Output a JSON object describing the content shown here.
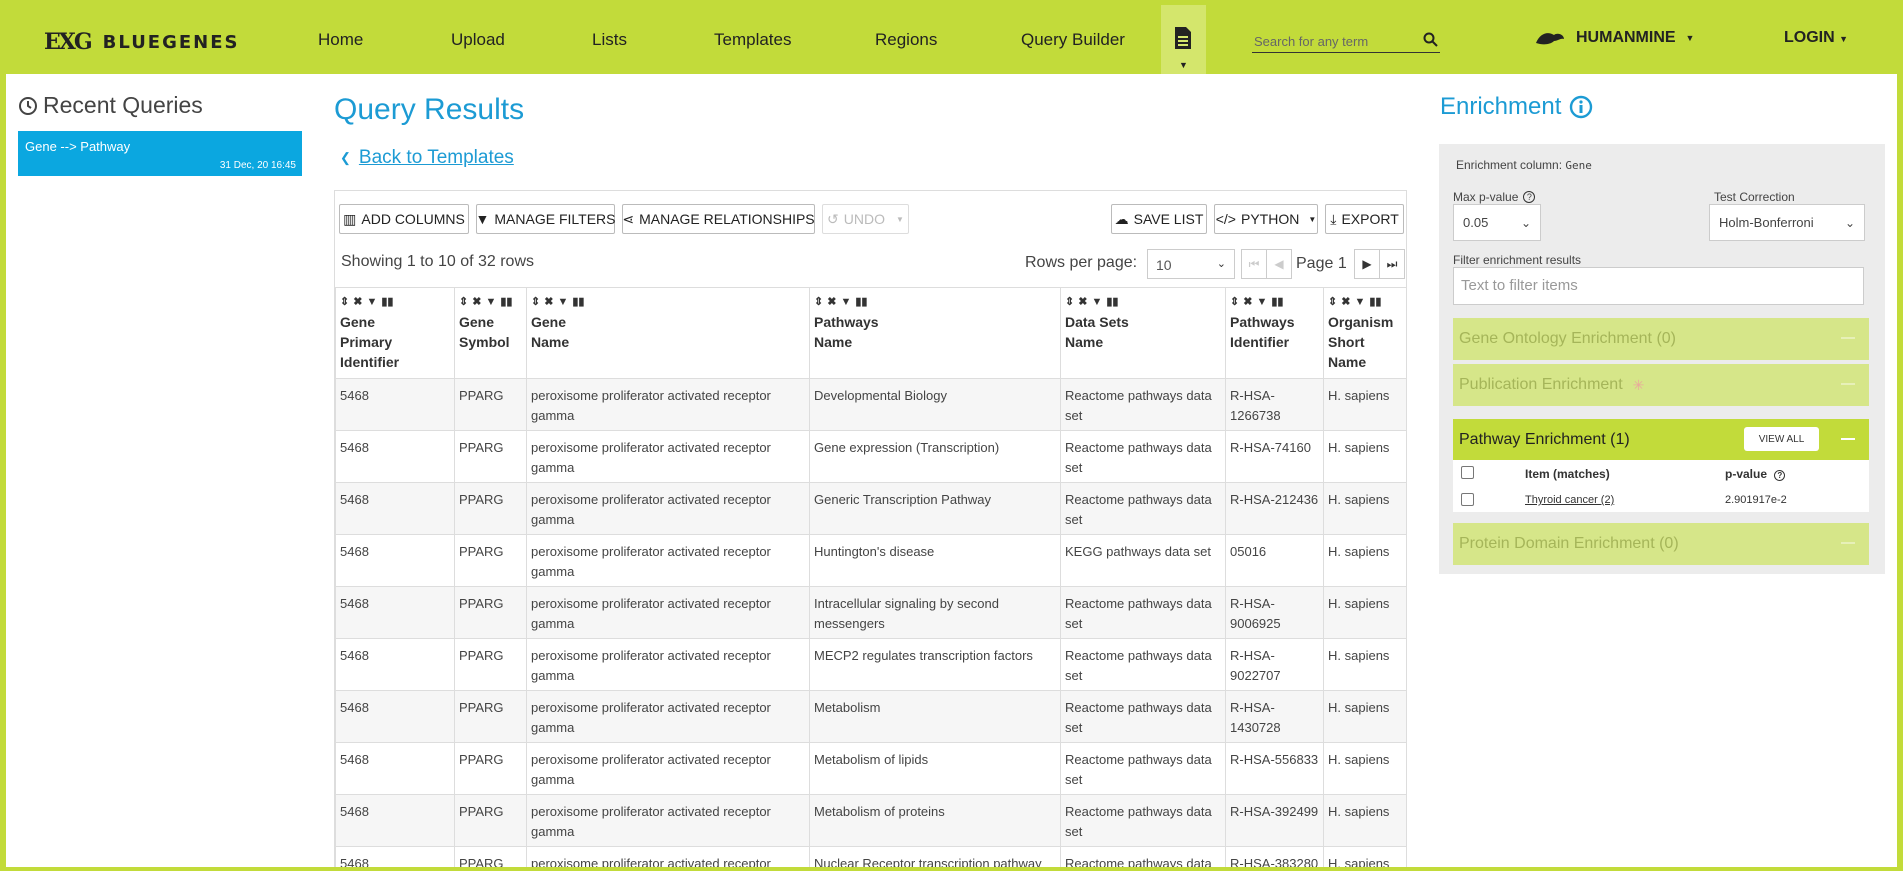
{
  "nav": {
    "logo": "EXG",
    "brand": "BLUEGENES",
    "links": [
      "Home",
      "Upload",
      "Lists",
      "Templates",
      "Regions",
      "Query Builder"
    ],
    "search_placeholder": "Search for any term",
    "mine": "HUMANMINE",
    "login": "LOGIN"
  },
  "recent": {
    "title": "Recent Queries",
    "item_name": "Gene --> Pathway",
    "item_date": "31 Dec, 20 16:45"
  },
  "results": {
    "title": "Query Results",
    "back": "Back to Templates",
    "toolbar": {
      "add_columns": "ADD COLUMNS",
      "manage_filters": "MANAGE FILTERS",
      "manage_relationships": "MANAGE RELATIONSHIPS",
      "undo": "UNDO",
      "save_list": "SAVE LIST",
      "python": "PYTHON",
      "export": "EXPORT"
    },
    "showing": "Showing 1 to 10 of 32 rows",
    "rows_per_page_label": "Rows per page:",
    "rows_per_page": "10",
    "page_label": "Page 1",
    "columns": [
      {
        "l1": "Gene",
        "l2": "Primary",
        "l3": "Identifier"
      },
      {
        "l1": "Gene",
        "l2": "Symbol",
        "l3": ""
      },
      {
        "l1": "Gene",
        "l2": "Name",
        "l3": ""
      },
      {
        "l1": "Pathways",
        "l2": "Name",
        "l3": ""
      },
      {
        "l1": "Data Sets",
        "l2": "Name",
        "l3": ""
      },
      {
        "l1": "Pathways",
        "l2": "Identifier",
        "l3": ""
      },
      {
        "l1": "Organism",
        "l2": "Short",
        "l3": "Name"
      }
    ],
    "rows": [
      [
        "5468",
        "PPARG",
        "peroxisome proliferator activated receptor gamma",
        "Developmental Biology",
        "Reactome pathways data set",
        "R-HSA-1266738",
        "H. sapiens"
      ],
      [
        "5468",
        "PPARG",
        "peroxisome proliferator activated receptor gamma",
        "Gene expression (Transcription)",
        "Reactome pathways data set",
        "R-HSA-74160",
        "H. sapiens"
      ],
      [
        "5468",
        "PPARG",
        "peroxisome proliferator activated receptor gamma",
        "Generic Transcription Pathway",
        "Reactome pathways data set",
        "R-HSA-212436",
        "H. sapiens"
      ],
      [
        "5468",
        "PPARG",
        "peroxisome proliferator activated receptor gamma",
        "Huntington's disease",
        "KEGG pathways data set",
        "05016",
        "H. sapiens"
      ],
      [
        "5468",
        "PPARG",
        "peroxisome proliferator activated receptor gamma",
        "Intracellular signaling by second messengers",
        "Reactome pathways data set",
        "R-HSA-9006925",
        "H. sapiens"
      ],
      [
        "5468",
        "PPARG",
        "peroxisome proliferator activated receptor gamma",
        "MECP2 regulates transcription factors",
        "Reactome pathways data set",
        "R-HSA-9022707",
        "H. sapiens"
      ],
      [
        "5468",
        "PPARG",
        "peroxisome proliferator activated receptor gamma",
        "Metabolism",
        "Reactome pathways data set",
        "R-HSA-1430728",
        "H. sapiens"
      ],
      [
        "5468",
        "PPARG",
        "peroxisome proliferator activated receptor gamma",
        "Metabolism of lipids",
        "Reactome pathways data set",
        "R-HSA-556833",
        "H. sapiens"
      ],
      [
        "5468",
        "PPARG",
        "peroxisome proliferator activated receptor gamma",
        "Metabolism of proteins",
        "Reactome pathways data set",
        "R-HSA-392499",
        "H. sapiens"
      ],
      [
        "5468",
        "PPARG",
        "peroxisome proliferator activated receptor gamma",
        "Nuclear Receptor transcription pathway",
        "Reactome pathways data set",
        "R-HSA-383280",
        "H. sapiens"
      ]
    ]
  },
  "enrichment": {
    "title": "Enrichment",
    "column_label": "Enrichment column:",
    "column_value": "Gene",
    "max_p_label": "Max p-value",
    "max_p_value": "0.05",
    "test_correction_label": "Test Correction",
    "test_correction_value": "Holm-Bonferroni",
    "filter_label": "Filter enrichment results",
    "filter_placeholder": "Text to filter items",
    "sections": {
      "go": "Gene Ontology Enrichment (0)",
      "publication": "Publication Enrichment",
      "pathway": "Pathway Enrichment (1)",
      "protein": "Protein Domain Enrichment (0)"
    },
    "view_all": "VIEW ALL",
    "table_headers": {
      "item": "Item (matches)",
      "pvalue": "p-value"
    },
    "item_name": "Thyroid cancer (2)",
    "item_pvalue": "2.901917e-2"
  },
  "colors": {
    "accent": "#c2db3a",
    "link": "#1c9bd4",
    "selected": "#0ba7e0"
  }
}
